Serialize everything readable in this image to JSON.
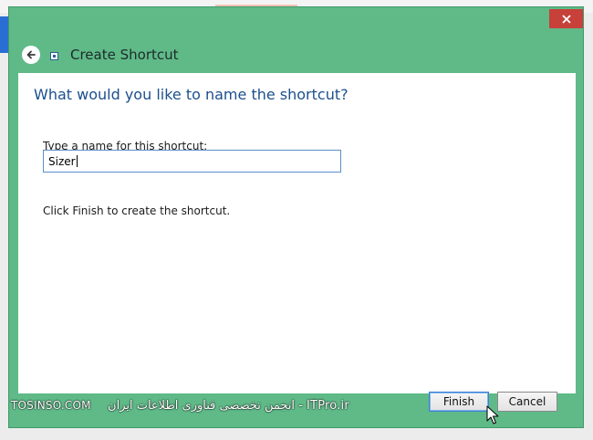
{
  "window": {
    "title": "Create Shortcut"
  },
  "main": {
    "heading": "What would you like to name the shortcut?",
    "field_label": "Type a name for this shortcut:",
    "name_value": "Sizer",
    "hint": "Click Finish to create the shortcut."
  },
  "footer": {
    "watermark_site": "TOSINSO.COM",
    "watermark_text": "انجمن تخصصی فناوری اطلاعات ایران - ITPro.ir",
    "finish_label": "Finish",
    "cancel_label": "Cancel"
  },
  "icons": {
    "back": "back-arrow-icon",
    "close": "close-icon",
    "title": "shortcut-icon",
    "cursor": "mouse-pointer-icon"
  },
  "colors": {
    "frame": "#5fba88",
    "close": "#c7403a",
    "heading": "#1c4f8d",
    "input_border": "#5b8fc8"
  }
}
